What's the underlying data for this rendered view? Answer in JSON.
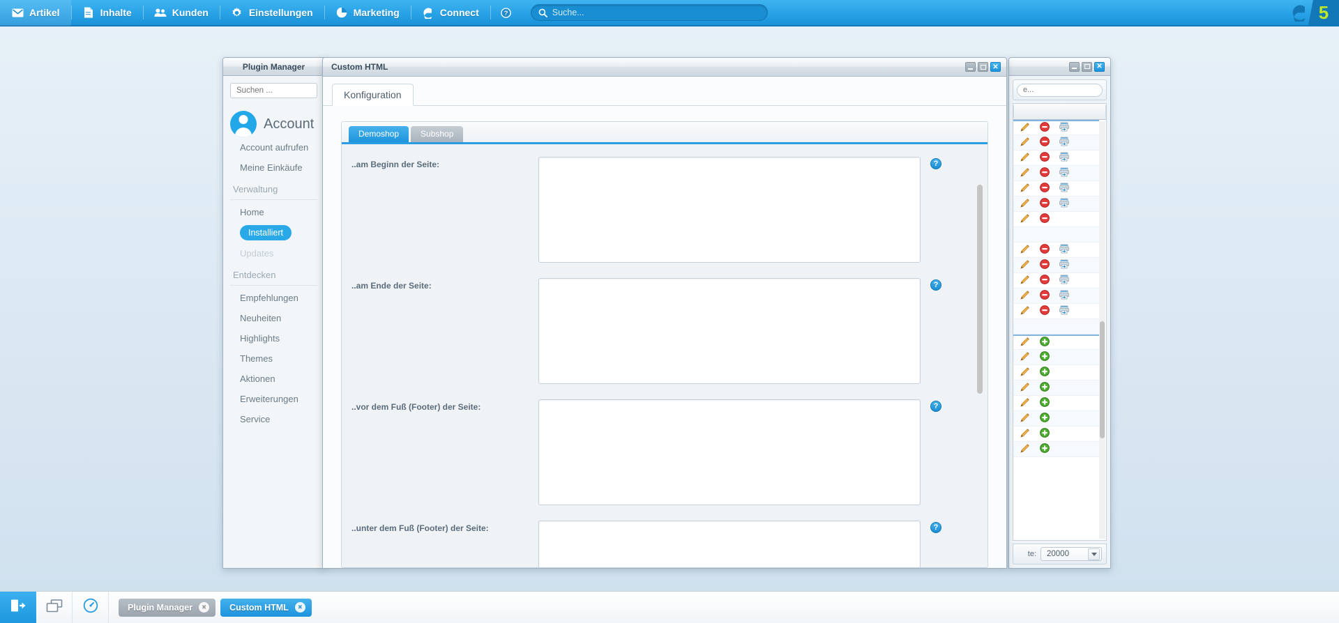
{
  "navbar": {
    "items": [
      {
        "label": "Artikel",
        "icon": "mail-icon"
      },
      {
        "label": "Inhalte",
        "icon": "document-icon"
      },
      {
        "label": "Kunden",
        "icon": "users-icon"
      },
      {
        "label": "Einstellungen",
        "icon": "gear-icon"
      },
      {
        "label": "Marketing",
        "icon": "pie-chart-icon"
      },
      {
        "label": "Connect",
        "icon": "connect-icon"
      }
    ],
    "help_icon": "question-circle-icon",
    "search": {
      "placeholder": "Suche...",
      "value": "",
      "icon": "search-icon"
    },
    "logo": {
      "icon": "shopware-logo-icon",
      "version": "5"
    }
  },
  "plugin_manager": {
    "title": "Plugin Manager",
    "search": {
      "placeholder": "Suchen ...",
      "value": ""
    },
    "account": {
      "label": "Account",
      "avatar": "user-avatar-icon"
    },
    "account_links": [
      "Account aufrufen",
      "Meine Einkäufe"
    ],
    "sections": [
      {
        "title": "Verwaltung",
        "items": [
          {
            "label": "Home",
            "state": "normal"
          },
          {
            "label": "Installiert",
            "state": "active"
          },
          {
            "label": "Updates",
            "state": "disabled"
          }
        ]
      },
      {
        "title": "Entdecken",
        "items": [
          {
            "label": "Empfehlungen",
            "state": "normal"
          },
          {
            "label": "Neuheiten",
            "state": "normal"
          },
          {
            "label": "Highlights",
            "state": "normal"
          },
          {
            "label": "Themes",
            "state": "normal"
          },
          {
            "label": "Aktionen",
            "state": "normal"
          },
          {
            "label": "Erweiterungen",
            "state": "normal"
          },
          {
            "label": "Service",
            "state": "normal"
          }
        ]
      }
    ]
  },
  "custom_html": {
    "title": "Custom HTML",
    "window_buttons": {
      "minimize": "minimize-icon",
      "maximize": "maximize-icon",
      "close": "×"
    },
    "tabs": [
      {
        "label": "Konfiguration",
        "active": true
      }
    ],
    "shop_tabs": [
      {
        "label": "Demoshop",
        "active": true
      },
      {
        "label": "Subshop",
        "active": false
      }
    ],
    "fields": [
      {
        "label": "..am Beginn der Seite:",
        "value": "",
        "help": "?"
      },
      {
        "label": "..am Ende der Seite:",
        "value": "",
        "help": "?"
      },
      {
        "label": "..vor dem Fuß (Footer) der Seite:",
        "value": "",
        "help": "?"
      },
      {
        "label": "..unter dem Fuß (Footer) der Seite:",
        "value": "",
        "help": "?"
      }
    ]
  },
  "grid_window": {
    "search": {
      "placeholder": "e...",
      "value": ""
    },
    "footer": {
      "label": "te:",
      "select_value": "20000"
    },
    "rows": [
      {
        "icons": [
          "pencil-icon",
          "minus-circle-icon",
          "printer-icon"
        ],
        "alt": false,
        "sep": true
      },
      {
        "icons": [
          "pencil-icon",
          "minus-circle-icon",
          "printer-icon"
        ],
        "alt": true
      },
      {
        "icons": [
          "pencil-icon",
          "minus-circle-icon",
          "printer-icon"
        ],
        "alt": false
      },
      {
        "icons": [
          "pencil-icon",
          "minus-circle-icon",
          "printer-icon"
        ],
        "alt": true
      },
      {
        "icons": [
          "pencil-icon",
          "minus-circle-icon",
          "printer-icon"
        ],
        "alt": false
      },
      {
        "icons": [
          "pencil-icon",
          "minus-circle-icon",
          "printer-icon"
        ],
        "alt": true
      },
      {
        "icons": [
          "pencil-icon",
          "minus-circle-icon"
        ],
        "alt": false
      },
      {
        "icons": [],
        "alt": true
      },
      {
        "icons": [
          "pencil-icon",
          "minus-circle-icon",
          "printer-icon"
        ],
        "alt": false
      },
      {
        "icons": [
          "pencil-icon",
          "minus-circle-icon",
          "printer-icon"
        ],
        "alt": true
      },
      {
        "icons": [
          "pencil-icon",
          "minus-circle-icon",
          "printer-icon"
        ],
        "alt": false
      },
      {
        "icons": [
          "pencil-icon",
          "minus-circle-icon",
          "printer-icon"
        ],
        "alt": true
      },
      {
        "icons": [
          "pencil-icon",
          "minus-circle-icon",
          "printer-icon"
        ],
        "alt": false
      },
      {
        "icons": [],
        "alt": true
      },
      {
        "icons": [
          "pencil-icon",
          "plus-circle-icon"
        ],
        "alt": false,
        "sep": true
      },
      {
        "icons": [
          "pencil-icon",
          "plus-circle-icon"
        ],
        "alt": true
      },
      {
        "icons": [
          "pencil-icon",
          "plus-circle-icon"
        ],
        "alt": false
      },
      {
        "icons": [
          "pencil-icon",
          "plus-circle-icon"
        ],
        "alt": true
      },
      {
        "icons": [
          "pencil-icon",
          "plus-circle-icon"
        ],
        "alt": false
      },
      {
        "icons": [
          "pencil-icon",
          "plus-circle-icon"
        ],
        "alt": true
      },
      {
        "icons": [
          "pencil-icon",
          "plus-circle-icon"
        ],
        "alt": false
      },
      {
        "icons": [
          "pencil-icon",
          "plus-circle-icon"
        ],
        "alt": true
      }
    ]
  },
  "taskbar": {
    "logout_icon": "logout-icon",
    "windows_icon": "windows-stack-icon",
    "dashboard_icon": "gauge-icon",
    "tasks": [
      {
        "label": "Plugin Manager",
        "active": false,
        "close": "×"
      },
      {
        "label": "Custom HTML",
        "active": true,
        "close": "×"
      }
    ]
  }
}
